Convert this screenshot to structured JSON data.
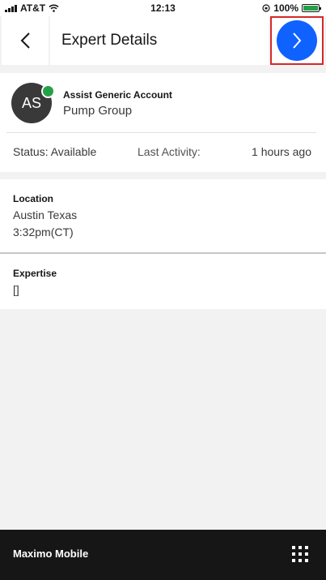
{
  "status_bar": {
    "carrier": "AT&T",
    "time": "12:13",
    "battery": "100%"
  },
  "header": {
    "title": "Expert Details"
  },
  "profile": {
    "initials": "AS",
    "name": "Assist Generic Account",
    "group": "Pump Group",
    "status": "Status: Available",
    "last_activity_label": "Last Activity:",
    "last_activity_value": "1 hours ago",
    "presence_color": "#24a148"
  },
  "location": {
    "title": "Location",
    "city": "Austin Texas",
    "local_time": "3:32pm(CT)"
  },
  "expertise": {
    "title": "Expertise",
    "value": "[]"
  },
  "footer": {
    "app_name": "Maximo Mobile"
  },
  "colors": {
    "accent": "#0f62fe",
    "highlight": "#d62828"
  }
}
